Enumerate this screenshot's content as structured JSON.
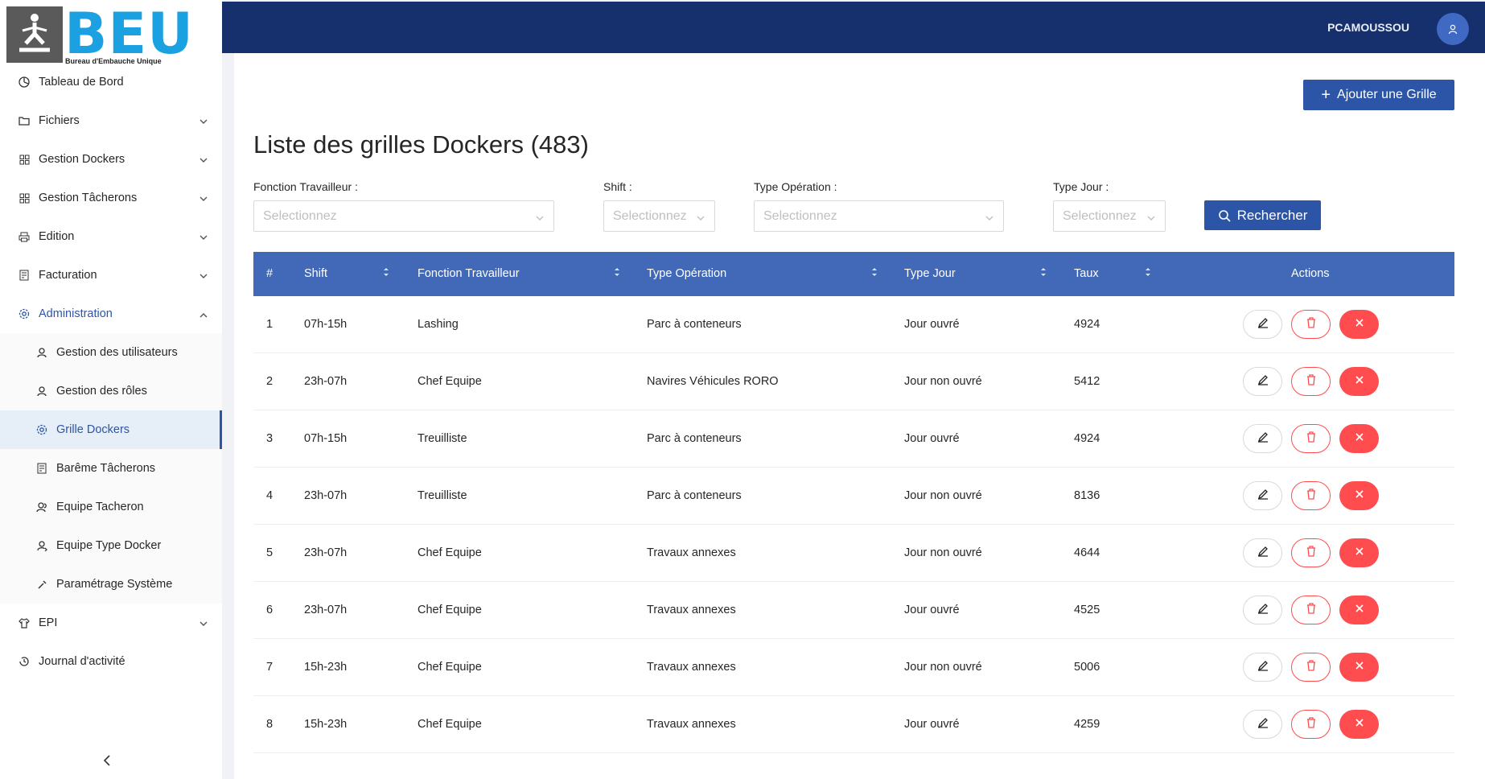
{
  "brand": {
    "logo_text": "BEU",
    "subtitle": "Bureau d'Embauche Unique",
    "accent_color": "#1ba1e2"
  },
  "header": {
    "username": "PCAMOUSSOU",
    "bg_color": "#16306d"
  },
  "sidebar": {
    "items": [
      {
        "label": "Tableau de Bord",
        "icon": "dashboard-icon"
      },
      {
        "label": "Fichiers",
        "icon": "folder-icon"
      },
      {
        "label": "Gestion Dockers",
        "icon": "grid-icon"
      },
      {
        "label": "Gestion Tâcherons",
        "icon": "grid-icon"
      },
      {
        "label": "Edition",
        "icon": "printer-icon"
      },
      {
        "label": "Facturation",
        "icon": "invoice-icon"
      },
      {
        "label": "Administration",
        "icon": "gear-icon"
      }
    ],
    "admin_sub": [
      {
        "label": "Gestion des utilisateurs",
        "icon": "user-icon"
      },
      {
        "label": "Gestion des rôles",
        "icon": "user-icon"
      },
      {
        "label": "Grille Dockers",
        "icon": "gear-icon"
      },
      {
        "label": "Barême Tâcherons",
        "icon": "invoice-icon"
      },
      {
        "label": "Equipe Tacheron",
        "icon": "team-icon"
      },
      {
        "label": "Equipe Type Docker",
        "icon": "user-tag-icon"
      },
      {
        "label": "Paramétrage Système",
        "icon": "tool-icon"
      }
    ],
    "bottom_items": [
      {
        "label": "EPI",
        "icon": "shirt-icon"
      },
      {
        "label": "Journal d'activité",
        "icon": "history-icon"
      }
    ],
    "collapse_icon": "chevron-left-icon"
  },
  "main": {
    "add_button": "Ajouter une Grille",
    "title": "Liste des grilles Dockers (483)",
    "filters": {
      "fonction_label": "Fonction Travailleur :",
      "shift_label": "Shift :",
      "operation_label": "Type Opération :",
      "jour_label": "Type Jour :",
      "placeholder": "Selectionnez",
      "search_button": "Rechercher"
    },
    "table": {
      "headers": [
        "#",
        "Shift",
        "Fonction Travailleur",
        "Type Opération",
        "Type Jour",
        "Taux",
        "Actions"
      ],
      "rows": [
        [
          "1",
          "07h-15h",
          "Lashing",
          "Parc à conteneurs",
          "Jour ouvré",
          "4924"
        ],
        [
          "2",
          "23h-07h",
          "Chef Equipe",
          "Navires Véhicules RORO",
          "Jour non ouvré",
          "5412"
        ],
        [
          "3",
          "07h-15h",
          "Treuilliste",
          "Parc à conteneurs",
          "Jour ouvré",
          "4924"
        ],
        [
          "4",
          "23h-07h",
          "Treuilliste",
          "Parc à conteneurs",
          "Jour non ouvré",
          "8136"
        ],
        [
          "5",
          "23h-07h",
          "Chef Equipe",
          "Travaux annexes",
          "Jour non ouvré",
          "4644"
        ],
        [
          "6",
          "23h-07h",
          "Chef Equipe",
          "Travaux annexes",
          "Jour ouvré",
          "4525"
        ],
        [
          "7",
          "15h-23h",
          "Chef Equipe",
          "Travaux annexes",
          "Jour non ouvré",
          "5006"
        ],
        [
          "8",
          "15h-23h",
          "Chef Equipe",
          "Travaux annexes",
          "Jour ouvré",
          "4259"
        ]
      ]
    }
  }
}
